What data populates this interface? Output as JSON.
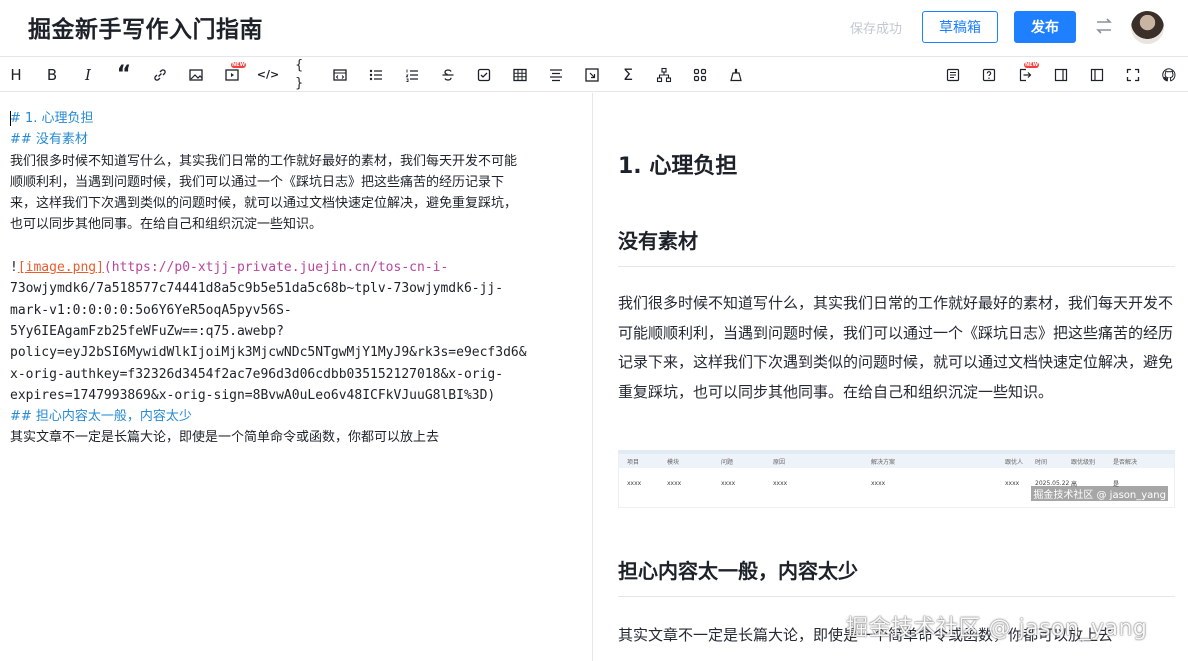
{
  "header": {
    "title": "掘金新手写作入门指南",
    "save_status": "保存成功",
    "draft_label": "草稿箱",
    "publish_label": "发布"
  },
  "toolbar": {
    "heading_label": "H",
    "bold_label": "B",
    "italic_label": "I",
    "quote_label": "“",
    "code_inline_label": "</>",
    "code_block_label": "{ }",
    "formula_label": "Σ",
    "new_badge": "NEW"
  },
  "editor": {
    "line1": "# 1. 心理负担",
    "line2": "## 没有素材",
    "line3": "我们很多时候不知道写什么，其实我们日常的工作就好最好的素材，我们每天开发不可能",
    "line4": "顺顺利利，当遇到问题时候，我们可以通过一个《踩坑日志》把这些痛苦的经历记录下",
    "line5": "来，这样我们下次遇到类似的问题时候，就可以通过文档快速定位解决，避免重复踩坑，",
    "line6": "也可以同步其他同事。在给自己和组织沉淀一些知识。",
    "img_bang": "!",
    "img_label": "[image.png]",
    "url1": "(https://p0-xtjj-private.juejin.cn/tos-cn-i-",
    "url2": "73owjymdk6/7a518577c74441d8a5c9b5e51da5c68b~tplv-73owjymdk6-jj-",
    "url3": "mark-v1:0:0:0:0:5o6Y6YeR5oqA5pyv56S-",
    "url4": "5Yy6IEAgamFzb25feWFuZw==:q75.awebp?",
    "url5": "policy=eyJ2bSI6MywidWlkIjoiMjk3MjcwNDc5NTgwMjY1MyJ9&rk3s=e9ecf3d6&",
    "url6": "x-orig-authkey=f32326d3454f2ac7e96d3d06cdbb035152127018&x-orig-",
    "url7": "expires=1747993869&x-orig-sign=8BvwA0uLeo6v48ICFkVJuuG8lBI%3D)",
    "line8": "## 担心内容太一般，内容太少",
    "line9": "其实文章不一定是长篇大论，即使是一个简单命令或函数，你都可以放上去"
  },
  "preview": {
    "h1": "1. 心理负担",
    "h2a": "没有素材",
    "para1": "我们很多时候不知道写什么，其实我们日常的工作就好最好的素材，我们每天开发不可能顺顺利利，当遇到问题时候，我们可以通过一个《踩坑日志》把这些痛苦的经历记录下来，这样我们下次遇到类似的问题时候，就可以通过文档快速定位解决，避免重复踩坑，也可以同步其他同事。在给自己和组织沉淀一些知识。",
    "h2b": "担心内容太一般，内容太少",
    "para2": "其实文章不一定是长篇大论，即使是一个简单命令或函数，你都可以放上去",
    "image": {
      "headers": [
        "项目",
        "模块",
        "问题",
        "原因",
        "解决方案",
        "跟优人",
        "时间",
        "跟优级别",
        "是否解决"
      ],
      "row": [
        "xxxx",
        "xxxx",
        "xxxx",
        "xxxx",
        "xxxx",
        "xxxx",
        "2025.05.22",
        "高",
        "是"
      ],
      "watermark": "掘金技术社区 @ jason_yang"
    }
  },
  "watermark": "掘金技术社区 @ jason_yang",
  "colors": {
    "accent": "#1e80ff",
    "heading_mark": "#268bd2",
    "link_label": "#e85d2f",
    "link_url": "#b8469b",
    "save_status": "#c2c8d1"
  }
}
